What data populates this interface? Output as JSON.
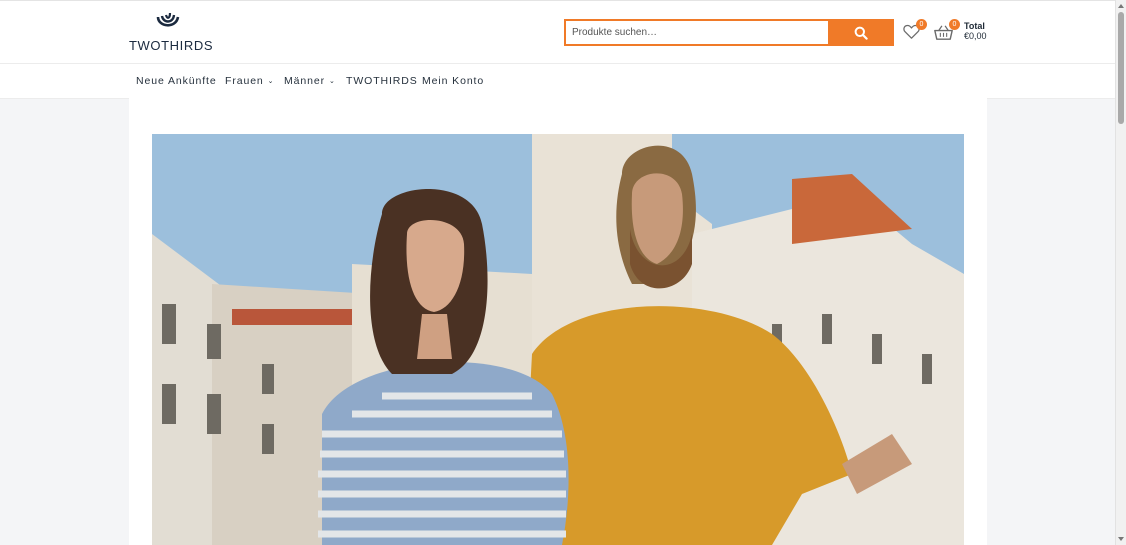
{
  "header": {
    "logo_text": "TWOTHIRDS",
    "search": {
      "placeholder": "Produkte suchen…"
    },
    "wishlist_count": "0",
    "cart": {
      "count": "0",
      "total_label": "Total",
      "total_value": "€0,00"
    }
  },
  "nav": {
    "items": [
      {
        "label": "Neue Ankünfte"
      },
      {
        "label": "Frauen",
        "has_dropdown": true
      },
      {
        "label": "Männer",
        "has_dropdown": true
      },
      {
        "label": "TWOTHIRDS"
      },
      {
        "label": "Mein Konto"
      }
    ]
  },
  "colors": {
    "accent": "#f07a28",
    "brand_navy": "#1b2a3f"
  }
}
